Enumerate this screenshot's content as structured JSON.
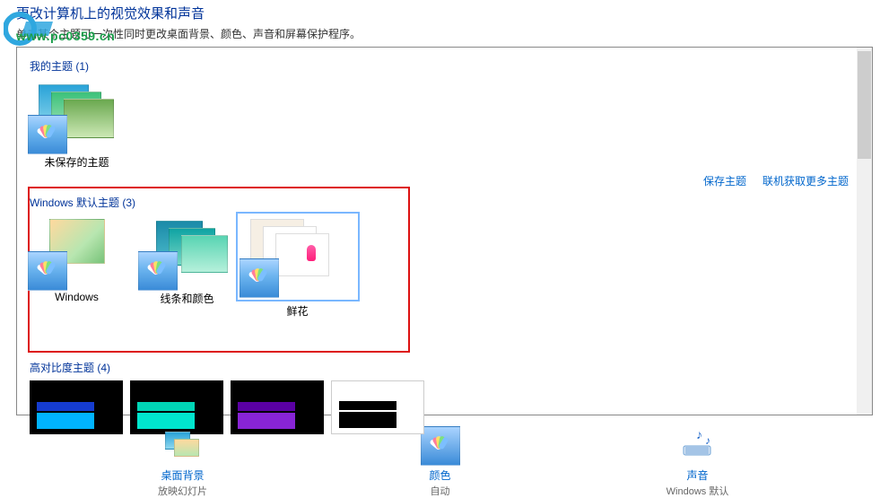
{
  "header": {
    "title": "更改计算机上的视觉效果和声音",
    "subtitle": "单击某个主题可一次性同时更改桌面背景、颜色、声音和屏幕保护程序。"
  },
  "watermark": {
    "url": "www.pc0359.cn"
  },
  "sections": {
    "my": {
      "label": "我的主题 (1)",
      "items": [
        {
          "name": "未保存的主题"
        }
      ]
    },
    "links": {
      "save": "保存主题",
      "more": "联机获取更多主题"
    },
    "def": {
      "label": "Windows 默认主题 (3)",
      "items": [
        {
          "name": "Windows"
        },
        {
          "name": "线条和颜色"
        },
        {
          "name": "鲜花"
        }
      ]
    },
    "hc": {
      "label": "高对比度主题 (4)"
    }
  },
  "bottom": {
    "bg": {
      "link": "桌面背景",
      "sub": "放映幻灯片"
    },
    "col": {
      "link": "颜色",
      "sub": "自动"
    },
    "snd": {
      "link": "声音",
      "sub": "Windows 默认"
    }
  }
}
